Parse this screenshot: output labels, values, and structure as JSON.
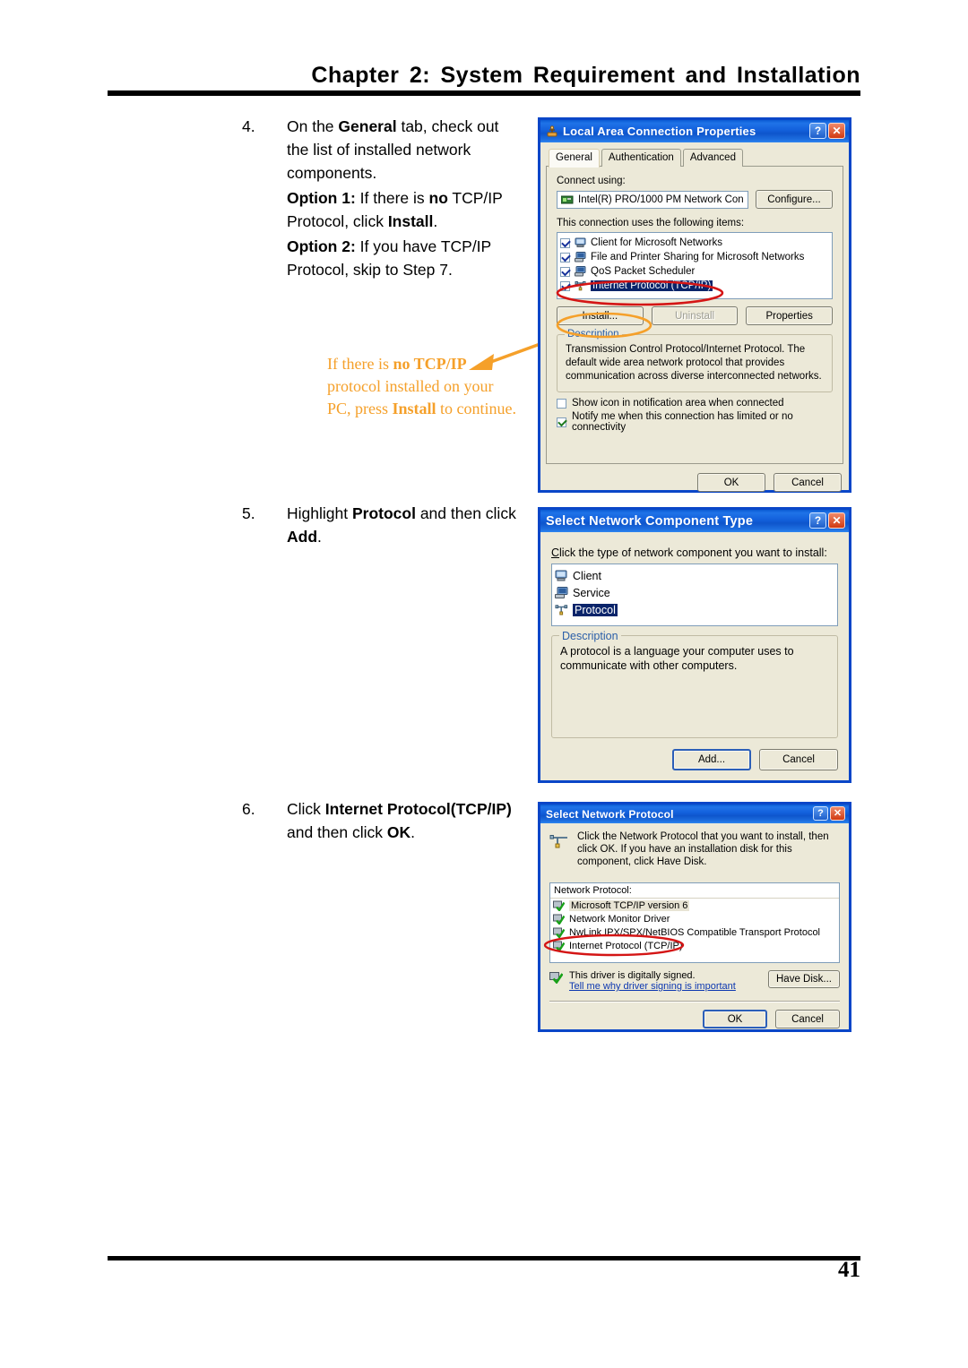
{
  "header": {
    "title": "Chapter 2: System Requirement and Installation"
  },
  "footer": {
    "page_number": "41"
  },
  "steps": [
    {
      "number": "4.",
      "lines": [
        "On the General tab, check out the list of installed network components.",
        "Option 1: If there is no TCP/IP Protocol, click Install.",
        "Option 2: If you have TCP/IP Protocol, skip to Step 7."
      ]
    },
    {
      "number": "5.",
      "lines": [
        "Highlight Protocol and then click Add."
      ]
    },
    {
      "number": "6.",
      "lines": [
        "Click Internet Protocol(TCP/IP) and then click OK."
      ]
    }
  ],
  "callout": {
    "line1_a": "If there is ",
    "line1_b": "no TCP/IP",
    "line2": "protocol installed on your",
    "line3_a": "PC, press ",
    "line3_b": "Install",
    "line3_c": " to continue.",
    "color": "#F5A02A"
  },
  "dialog1": {
    "title": "Local Area Connection Properties",
    "help_button": "?",
    "close_button": "✕",
    "tabs": [
      "General",
      "Authentication",
      "Advanced"
    ],
    "active_tab": "General",
    "connect_using_label": "Connect using:",
    "adapter": "Intel(R) PRO/1000 PM Network Con",
    "configure_button": "Configure...",
    "items_label": "This connection uses the following items:",
    "items": [
      {
        "label": "Client for Microsoft Networks",
        "checked": true,
        "selected": false
      },
      {
        "label": "File and Printer Sharing for Microsoft Networks",
        "checked": true,
        "selected": false
      },
      {
        "label": "QoS Packet Scheduler",
        "checked": true,
        "selected": false
      },
      {
        "label": "Internet Protocol (TCP/IP)",
        "checked": true,
        "selected": true
      }
    ],
    "install_button": "Install...",
    "uninstall_button": "Uninstall",
    "properties_button": "Properties",
    "description_title": "Description",
    "description_text": "Transmission Control Protocol/Internet Protocol. The default wide area network protocol that provides communication across diverse interconnected networks.",
    "checkbox_show_icon": {
      "label": "Show icon in notification area when connected",
      "checked": false
    },
    "checkbox_notify": {
      "label": "Notify me when this connection has limited or no connectivity",
      "checked": true
    },
    "ok_button": "OK",
    "cancel_button": "Cancel"
  },
  "dialog2": {
    "title": "Select Network Component Type",
    "help_button": "?",
    "close_button": "✕",
    "prompt": "Click the type of network component you want to install:",
    "items": [
      {
        "label": "Client",
        "selected": false
      },
      {
        "label": "Service",
        "selected": false
      },
      {
        "label": "Protocol",
        "selected": true
      }
    ],
    "description_title": "Description",
    "description_text": "A protocol is a language your computer uses to communicate with other computers.",
    "add_button": "Add...",
    "cancel_button": "Cancel"
  },
  "dialog3": {
    "title": "Select Network Protocol",
    "help_button": "?",
    "close_button": "✕",
    "prompt": "Click the Network Protocol that you want to install, then click OK. If you have an installation disk for this component, click Have Disk.",
    "list_label": "Network Protocol:",
    "items": [
      {
        "label": "Microsoft TCP/IP version 6",
        "soft_selected": true
      },
      {
        "label": "Network Monitor Driver",
        "soft_selected": false
      },
      {
        "label": "NwLink IPX/SPX/NetBIOS Compatible Transport Protocol",
        "soft_selected": false
      },
      {
        "label": "Internet Protocol (TCP/IP)",
        "soft_selected": false
      }
    ],
    "signed_text": "This driver is digitally signed.",
    "signing_link": "Tell me why driver signing is important",
    "have_disk_button": "Have Disk...",
    "ok_button": "OK",
    "cancel_button": "Cancel"
  },
  "annotations": {
    "red_ellipse_color": "#D41515",
    "orange_ellipse_color": "#F5A02A"
  }
}
